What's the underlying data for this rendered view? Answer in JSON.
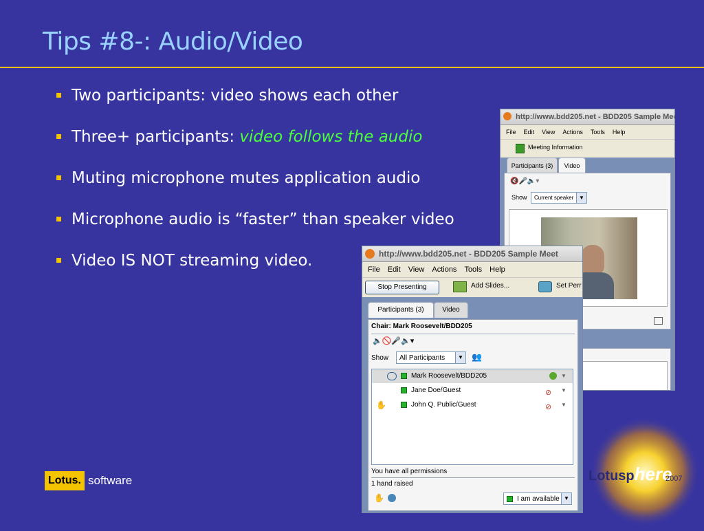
{
  "slide": {
    "title": "Tips #8-: Audio/Video",
    "bullets": [
      {
        "text": "Two participants: video shows each other"
      },
      {
        "prefix": "Three+ participants: ",
        "highlight": "video follows the audio"
      },
      {
        "text": "Muting microphone mutes application audio"
      },
      {
        "text": "Microphone audio is “faster” than speaker video"
      },
      {
        "text": "Video IS NOT streaming video."
      }
    ]
  },
  "back_window": {
    "title": "http://www.bdd205.net - BDD205 Sample Mee",
    "menu": [
      "File",
      "Edit",
      "View",
      "Actions",
      "Tools",
      "Help"
    ],
    "toolbar_meeting_info": "Meeting Information",
    "tabs": [
      "Participants (3)",
      "Video"
    ],
    "show_label": "Show",
    "show_value": "Current speaker"
  },
  "front_window": {
    "title": "http://www.bdd205.net - BDD205 Sample Meet",
    "menu": [
      "File",
      "Edit",
      "View",
      "Actions",
      "Tools",
      "Help"
    ],
    "stop_presenting": "Stop Presenting",
    "add_slides": "Add Slides...",
    "set_perm": "Set Perr",
    "tabs": [
      "Participants (3)",
      "Video"
    ],
    "chair": "Chair: Mark Roosevelt/BDD205",
    "show_label": "Show",
    "show_value": "All Participants",
    "participants": [
      "Mark Roosevelt/BDD205",
      "Jane Doe/Guest",
      "John Q. Public/Guest"
    ],
    "permissions": "You have all permissions",
    "hands": "1 hand raised",
    "availability": "I am available"
  },
  "branding": {
    "lotus": "Lotus.",
    "software": "software",
    "sphere_left": "Lotusp",
    "sphere_here": "here",
    "sphere_year": "2007"
  },
  "colors": {
    "background": "#3734a0",
    "title": "#9ad2ff",
    "accent": "#f2c200",
    "highlight": "#4cff3c"
  }
}
